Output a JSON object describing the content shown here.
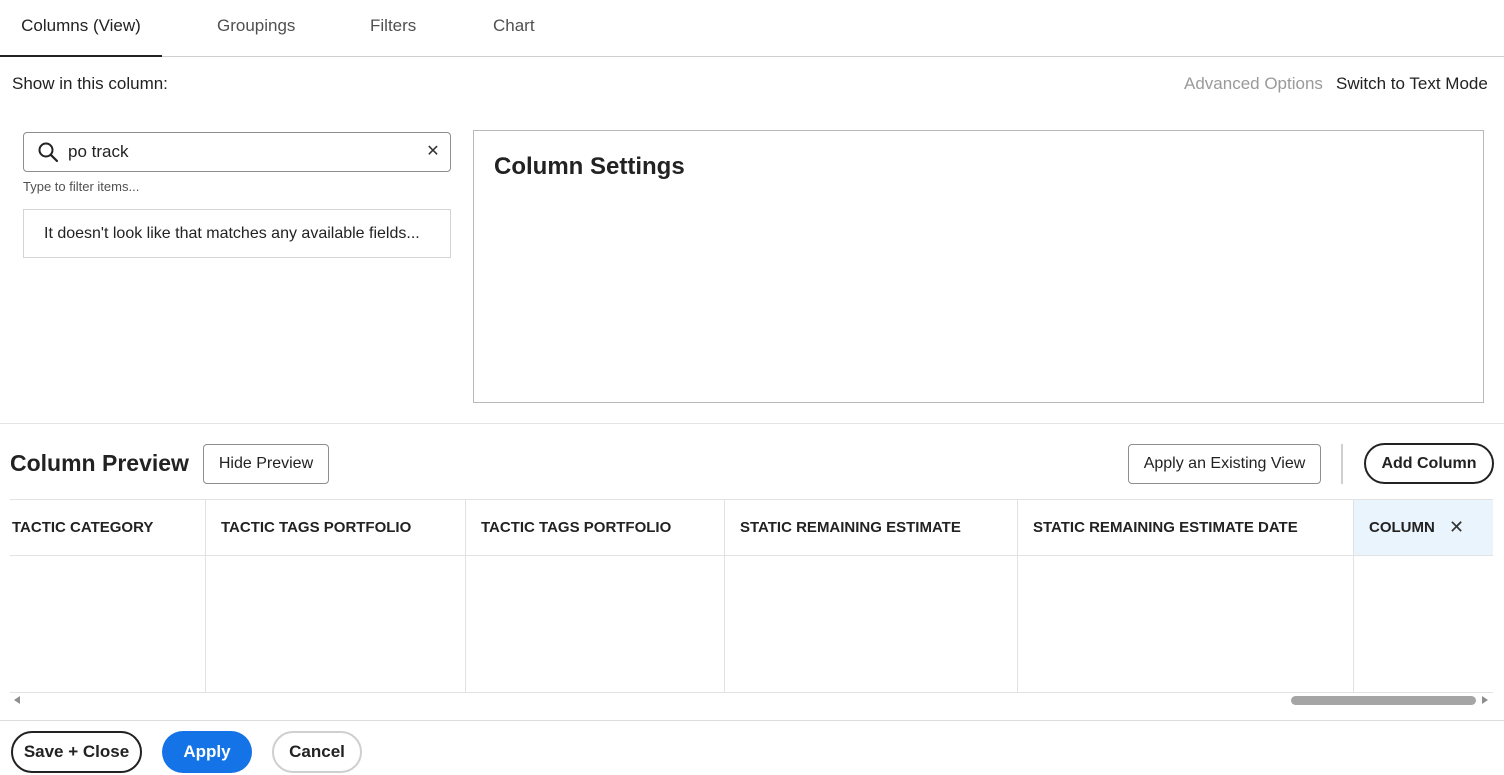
{
  "tabs": [
    {
      "label": "Columns (View)",
      "active": true
    },
    {
      "label": "Groupings",
      "active": false
    },
    {
      "label": "Filters",
      "active": false
    },
    {
      "label": "Chart",
      "active": false
    }
  ],
  "column_source": {
    "label": "Show in this column:",
    "advanced_options": "Advanced Options",
    "switch_mode": "Switch to Text Mode"
  },
  "search": {
    "value": "po track",
    "hint": "Type to filter items...",
    "no_results": "It doesn't look like that matches any available fields...",
    "clear_glyph": "✕"
  },
  "settings": {
    "title": "Column Settings"
  },
  "preview": {
    "title": "Column Preview",
    "hide_button": "Hide Preview",
    "apply_existing_button": "Apply an Existing View",
    "add_column_button": "Add Column",
    "columns": [
      "TACTIC CATEGORY",
      "TACTIC TAGS PORTFOLIO",
      "TACTIC TAGS PORTFOLIO",
      "STATIC REMAINING ESTIMATE",
      "STATIC REMAINING ESTIMATE DATE",
      "COLUMN"
    ],
    "close_glyph": "✕"
  },
  "footer": {
    "save_close": "Save + Close",
    "apply": "Apply",
    "cancel": "Cancel"
  },
  "colors": {
    "primary": "#1473e6",
    "selected_column": "#eaf4fc",
    "muted_text": "#9a9a9a"
  },
  "icons": {
    "search": "search-icon",
    "clear": "close-icon",
    "remove_column": "close-icon"
  }
}
